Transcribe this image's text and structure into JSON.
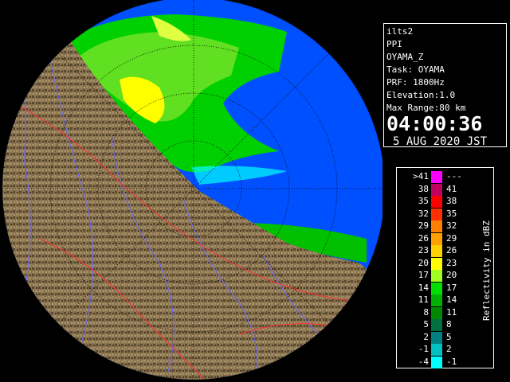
{
  "info": {
    "radar_name": "ilts2",
    "display_mode": "PPI",
    "product": "OYAMA_Z",
    "task": "Task: OYAMA",
    "prf": "PRF: 1800Hz",
    "elevation": "Elevation:1.0",
    "max_range": "Max Range:80 km",
    "time": "04:00:36",
    "date": "5 AUG 2020 JST"
  },
  "legend": {
    "unit_label": "Reflectivity in dBZ",
    "rows": [
      {
        "low": ">41",
        "high": "---",
        "color": "#ff00ff"
      },
      {
        "low": "38",
        "high": "41",
        "color": "#c00060"
      },
      {
        "low": "35",
        "high": "38",
        "color": "#ff0000"
      },
      {
        "low": "32",
        "high": "35",
        "color": "#ff3000"
      },
      {
        "low": "29",
        "high": "32",
        "color": "#ff8000"
      },
      {
        "low": "26",
        "high": "29",
        "color": "#ffa000"
      },
      {
        "low": "23",
        "high": "26",
        "color": "#ffd000"
      },
      {
        "low": "20",
        "high": "23",
        "color": "#ffff00"
      },
      {
        "low": "17",
        "high": "20",
        "color": "#a0ff20"
      },
      {
        "low": "14",
        "high": "17",
        "color": "#00e000"
      },
      {
        "low": "11",
        "high": "14",
        "color": "#00b000"
      },
      {
        "low": "8",
        "high": "11",
        "color": "#008800"
      },
      {
        "low": "5",
        "high": "8",
        "color": "#007040"
      },
      {
        "low": "2",
        "high": "5",
        "color": "#008080"
      },
      {
        "low": "-1",
        "high": "2",
        "color": "#00c0c0"
      },
      {
        "low": "-4",
        "high": "-1",
        "color": "#00ffff"
      }
    ]
  },
  "colors": {
    "sea": "#0040e0",
    "sea_noecho": "#0050ff",
    "land": "#8a7350",
    "land_dark": "#5a4a30",
    "river": "#6a6aff",
    "boundary": "#ff3030",
    "range_ring": "#000000"
  }
}
